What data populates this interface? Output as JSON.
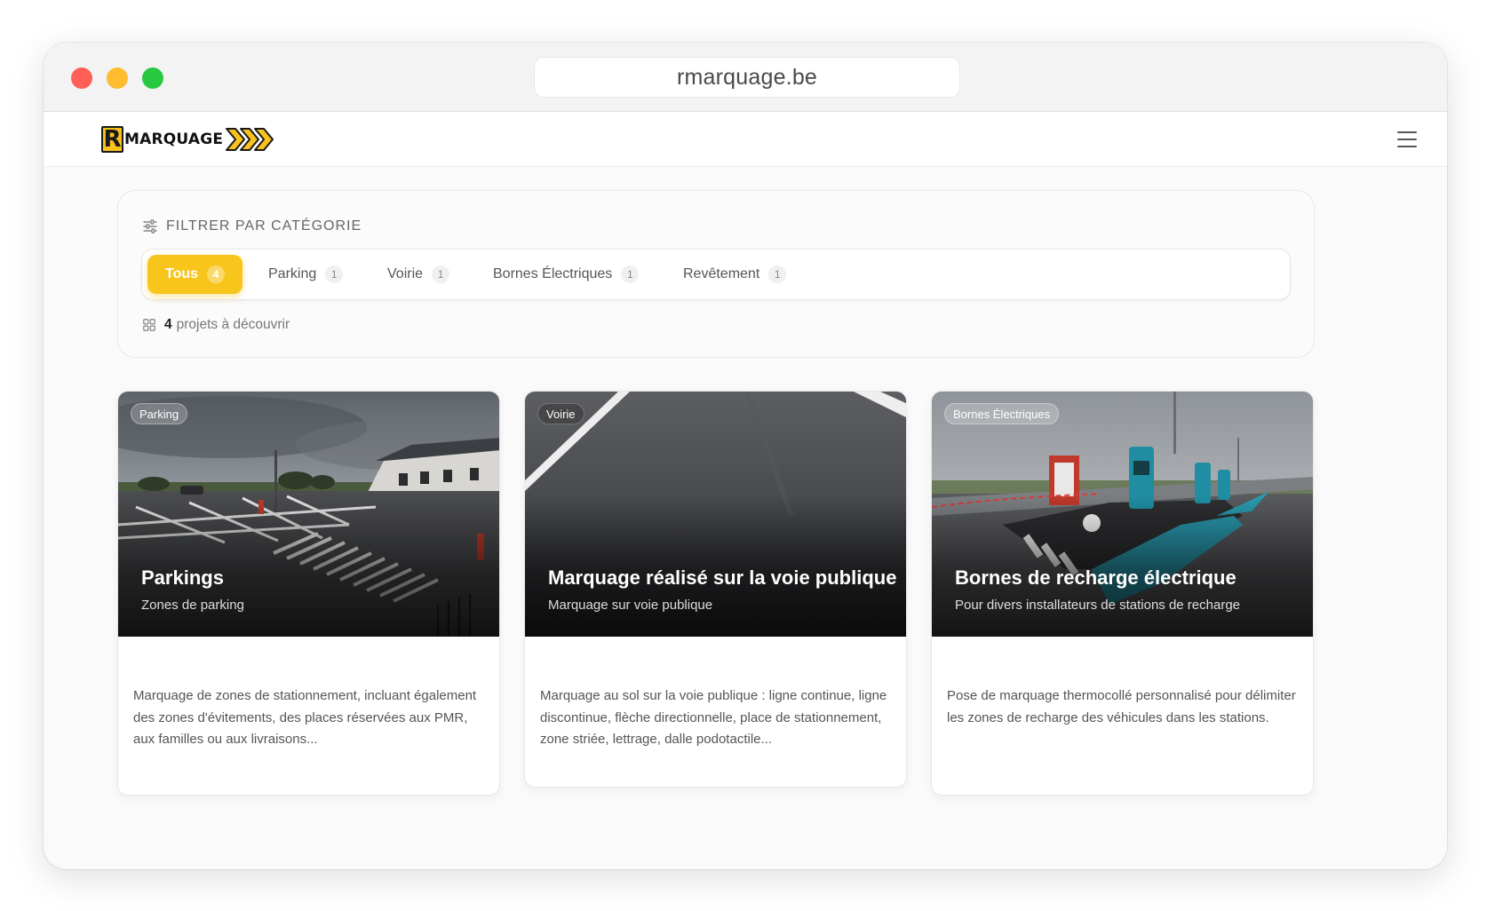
{
  "browser": {
    "url": "rmarquage.be"
  },
  "navbar": {
    "logo_letter": "R",
    "logo_text": "MARQUAGE"
  },
  "filter": {
    "title": "FILTRER PAR CATÉGORIE",
    "tabs": [
      {
        "label": "Tous",
        "count": "4",
        "active": true
      },
      {
        "label": "Parking",
        "count": "1",
        "active": false
      },
      {
        "label": "Voirie",
        "count": "1",
        "active": false
      },
      {
        "label": "Bornes Électriques",
        "count": "1",
        "active": false
      },
      {
        "label": "Revêtement",
        "count": "1",
        "active": false
      }
    ],
    "project_count": "4",
    "project_count_label": "projets à découvrir"
  },
  "projects": [
    {
      "tag": "Parking",
      "title": "Parkings",
      "subtitle": "Zones de parking",
      "description": "Marquage de zones de stationnement, incluant également des zones d'évitements, des places réservées aux PMR, aux familles ou aux livraisons..."
    },
    {
      "tag": "Voirie",
      "title": "Marquage réalisé sur la voie publique",
      "subtitle": "Marquage sur voie publique",
      "description": "Marquage au sol sur la voie publique : ligne continue, ligne discontinue, flèche directionnelle, place de stationnement, zone striée, lettrage, dalle podotactile..."
    },
    {
      "tag": "Bornes Électriques",
      "title": "Bornes de recharge électrique",
      "subtitle": "Pour divers installateurs de stations de recharge",
      "description": "Pose de marquage thermocollé personnalisé pour délimiter les zones de recharge des véhicules dans les stations."
    }
  ],
  "colors": {
    "accent": "#f8c51c",
    "text_dark": "#222222",
    "text_muted": "#666666"
  }
}
